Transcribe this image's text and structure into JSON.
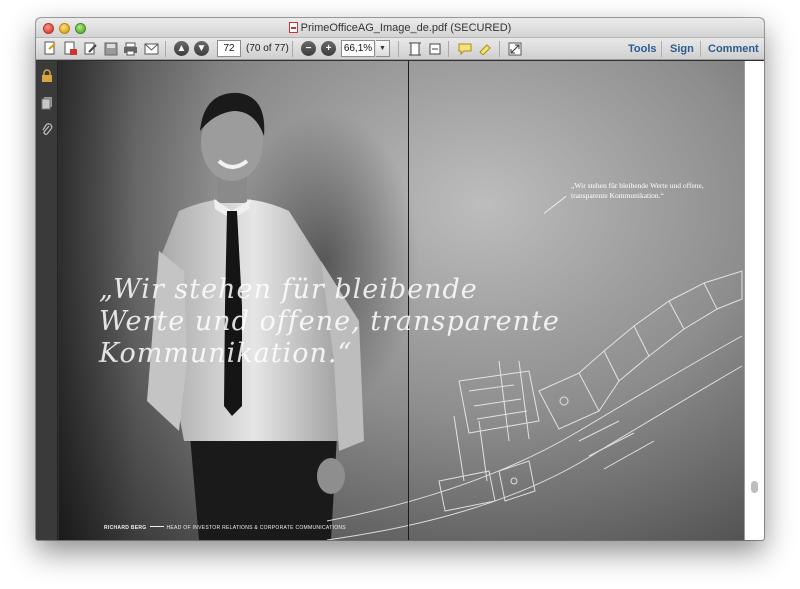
{
  "window": {
    "title": "PrimeOfficeAG_Image_de.pdf (SECURED)"
  },
  "toolbar": {
    "page_number": "72",
    "page_count": "(70 of 77)",
    "zoom": "66,1%",
    "tools_label": "Tools",
    "sign_label": "Sign",
    "comment_label": "Comment"
  },
  "document": {
    "quote_line1": "„Wir stehen für bleibende",
    "quote_line2": "Werte und offene, transparente",
    "quote_line3": "Kommunikation.“",
    "small_quote": "„Wir stehen für bleibende Werte und offene, transparente Kommunikation.“",
    "caption_name": "RICHARD BERG",
    "caption_role": "HEAD OF INVESTOR RELATIONS & CORPORATE COMMUNICATIONS"
  },
  "colors": {
    "link": "#2d5c8f",
    "window_bg": "#2f2f2f"
  }
}
